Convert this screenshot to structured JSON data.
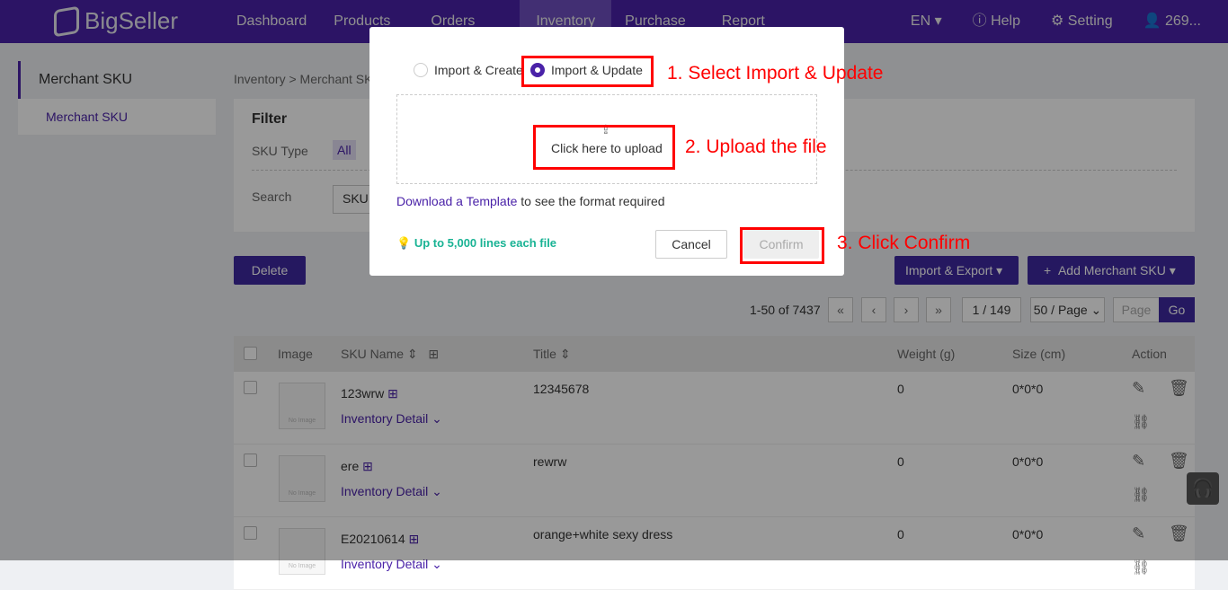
{
  "header": {
    "brand": "BigSeller",
    "nav": [
      "Dashboard",
      "Products",
      "Orders",
      "Inventory",
      "Purchase",
      "Report"
    ],
    "active": "Inventory",
    "lang": "EN",
    "help": "Help",
    "setting": "Setting",
    "user": "269..."
  },
  "sidebar": {
    "title": "Merchant SKU",
    "items": [
      "Merchant SKU"
    ]
  },
  "breadcrumb": "Inventory  >  Merchant SKU",
  "filter": {
    "title": "Filter",
    "sku_type_label": "SKU Type",
    "sku_type_value": "All",
    "search_label": "Search",
    "search_select": "SKU"
  },
  "toolbar": {
    "delete": "Delete",
    "import_export": "Import & Export",
    "add_sku": "Add Merchant SKU"
  },
  "pagination": {
    "range": "1-50 of 7437",
    "page": "1 / 149",
    "per_page": "50 / Page",
    "page_placeholder": "Page",
    "go": "Go"
  },
  "table": {
    "headers": [
      "Image",
      "SKU Name",
      "Title",
      "Weight (g)",
      "Size (cm)",
      "Action"
    ],
    "rows": [
      {
        "sku": "123wrw",
        "detail": "Inventory Detail",
        "title": "12345678",
        "weight": "0",
        "size": "0*0*0"
      },
      {
        "sku": "ere",
        "detail": "Inventory Detail",
        "title": "rewrw",
        "weight": "0",
        "size": "0*0*0"
      },
      {
        "sku": "E20210614",
        "detail": "Inventory Detail",
        "title": "orange+white sexy dress",
        "weight": "0",
        "size": "0*0*0"
      }
    ],
    "no_image": "No Image"
  },
  "modal": {
    "option_create": "Import & Create",
    "option_update": "Import & Update",
    "selected": "Import & Update",
    "upload": "Click here to upload",
    "download_link": "Download a Template",
    "download_rest": " to see the format required",
    "tip": "Up to 5,000 lines each file",
    "cancel": "Cancel",
    "confirm": "Confirm"
  },
  "annotations": [
    "1. Select Import & Update",
    "2. Upload the file",
    "3. Click Confirm"
  ],
  "colors": {
    "brand": "#4a22a8",
    "annotation": "#ff0000",
    "tip": "#19b394"
  }
}
